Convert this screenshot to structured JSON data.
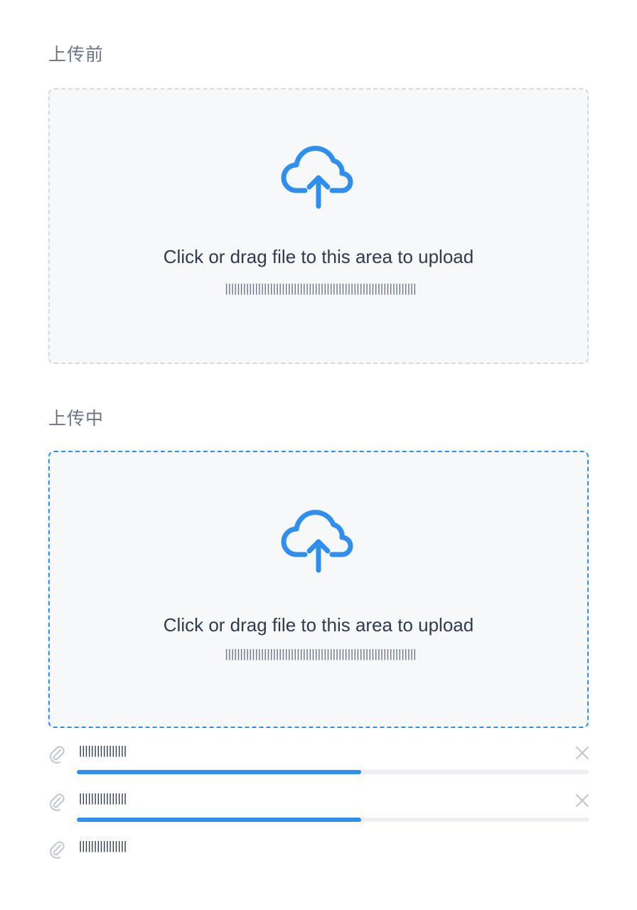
{
  "sections": [
    {
      "title": "上传前",
      "state": "idle",
      "dropzone": {
        "icon": "cloud-upload-icon",
        "text": "Click or drag file to this area to upload",
        "hint": "||||||||||||||||||||||||||||||||||||||||||||||||||||||||||||||||"
      }
    },
    {
      "title": "上传中",
      "state": "uploading",
      "dropzone": {
        "icon": "cloud-upload-icon",
        "text": "Click or drag file to this area to upload",
        "hint": "||||||||||||||||||||||||||||||||||||||||||||||||||||||||||||||||"
      }
    }
  ],
  "files": [
    {
      "name": "||||||||||||||||",
      "icon": "paperclip-icon",
      "progress": 0.555,
      "removable": true
    },
    {
      "name": "||||||||||||||||",
      "icon": "paperclip-icon",
      "progress": 0.555,
      "removable": true
    },
    {
      "name": "||||||||||||||||",
      "icon": "paperclip-icon",
      "removable": false
    }
  ],
  "colors": {
    "accent": "#2f8fee",
    "text": "#2e3a4e",
    "muted": "#6b7587",
    "border_idle": "#d6d9de",
    "dropzone_bg": "#f7f8fa",
    "track": "#eceef2"
  }
}
